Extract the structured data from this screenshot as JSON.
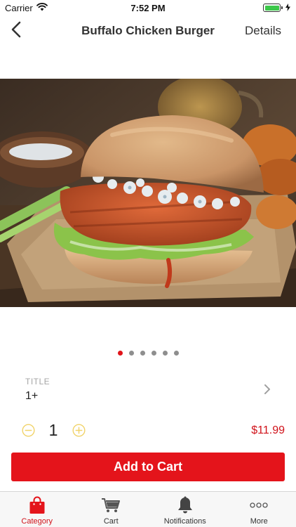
{
  "status_bar": {
    "carrier": "Carrier",
    "time": "7:52 PM",
    "battery_level": 1.0
  },
  "nav": {
    "title": "Buffalo Chicken Burger",
    "details_label": "Details",
    "back_icon": "chevron-left-icon"
  },
  "product": {
    "image_subject": "buffalo-chicken-burger-photo",
    "page_count": 6,
    "active_page": 1
  },
  "option": {
    "caption": "TITLE",
    "value": "1+",
    "icon": "chevron-right-icon"
  },
  "quantity": {
    "value": "1",
    "minus_icon": "minus-circle-icon",
    "plus_icon": "plus-circle-icon"
  },
  "price": "$11.99",
  "add_to_cart_label": "Add to Cart",
  "tabs": [
    {
      "label": "Category",
      "icon": "shopping-bag-icon",
      "active": true
    },
    {
      "label": "Cart",
      "icon": "cart-icon",
      "active": false
    },
    {
      "label": "Notifications",
      "icon": "bell-icon",
      "active": false
    },
    {
      "label": "More",
      "icon": "more-dots-icon",
      "active": false
    }
  ],
  "colors": {
    "accent": "#e4141b",
    "pager_inactive": "#8e8e8e",
    "stepper_disabled": "#f1d36a"
  }
}
